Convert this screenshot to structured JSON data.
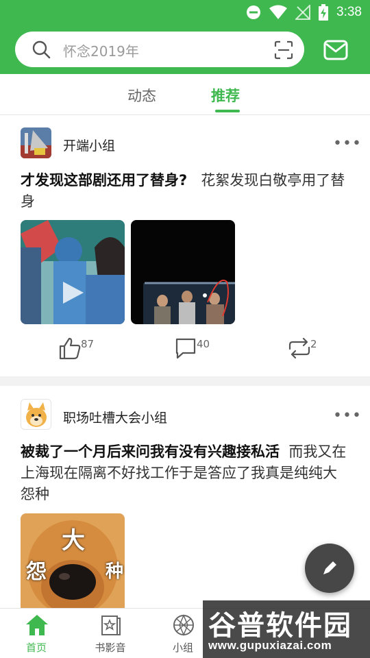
{
  "status_bar": {
    "time": "3:38"
  },
  "search": {
    "placeholder": "怀念2019年"
  },
  "tabs": [
    {
      "label": "动态",
      "active": false
    },
    {
      "label": "推荐",
      "active": true
    }
  ],
  "posts": [
    {
      "group": "开端小组",
      "title": "才发现这部剧还用了替身?",
      "body": "花絮发现白敬亭用了替身",
      "images": 2,
      "likes": "87",
      "comments": "40",
      "reposts": "2"
    },
    {
      "group": "职场吐槽大会小组",
      "title": "被裁了一个月后来问我有没有兴趣接私活",
      "body": "而我又在上海现在隔离不好找工作于是答应了我真是纯纯大怨种",
      "meme_text": {
        "top": "大",
        "left": "怨",
        "right": "种"
      }
    }
  ],
  "bottom_nav": [
    {
      "label": "首页",
      "active": true
    },
    {
      "label": "书影音",
      "active": false
    },
    {
      "label": "小组",
      "active": false
    }
  ],
  "watermark": {
    "cn": "谷普软件园",
    "url": "www.gupuxiazai.com"
  },
  "colors": {
    "brand_green": "#3fb94f",
    "fab": "#474747"
  }
}
